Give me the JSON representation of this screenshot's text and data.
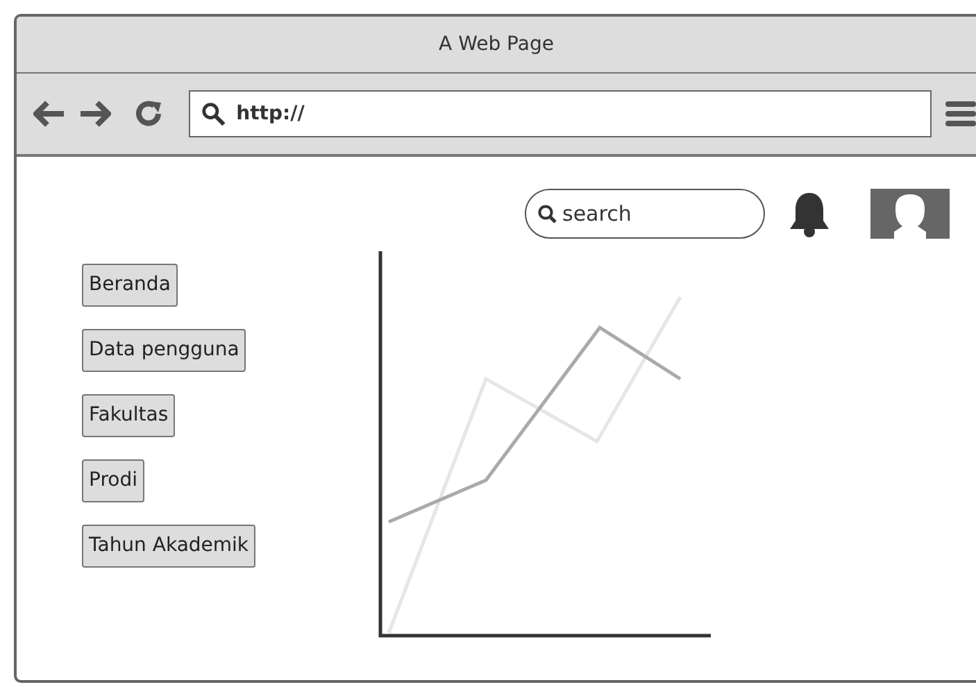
{
  "window": {
    "title": "A Web Page"
  },
  "address_bar": {
    "value": "http://"
  },
  "search": {
    "placeholder": "search"
  },
  "nav_buttons": [
    {
      "label": "Beranda"
    },
    {
      "label": "Data pengguna"
    },
    {
      "label": "Fakultas"
    },
    {
      "label": "Prodi"
    },
    {
      "label": "Tahun Akademik"
    }
  ]
}
